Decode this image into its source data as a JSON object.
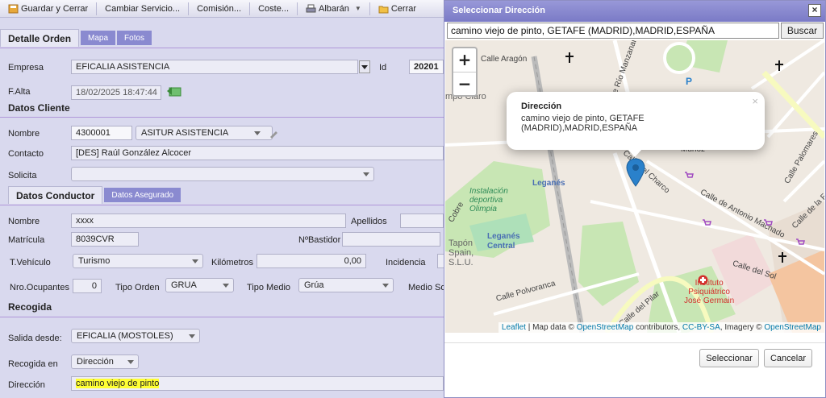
{
  "toolbar": {
    "save_close": "Guardar y Cerrar",
    "change_service": "Cambiar Servicio...",
    "commission": "Comisión...",
    "cost": "Coste...",
    "delivery_note": "Albarán",
    "close": "Cerrar"
  },
  "order": {
    "tab_active": "Detalle Orden",
    "tab_map": "Mapa",
    "tab_photos": "Fotos",
    "company_label": "Empresa",
    "company_value": "EFICALIA ASISTENCIA",
    "id_label": "Id",
    "id_value": "20201",
    "falta_label": "F.Alta",
    "falta_value": "18/02/2025 18:47:44"
  },
  "client": {
    "title": "Datos Cliente",
    "name_label": "Nombre",
    "name_code": "4300001",
    "name_value": "ASITUR ASISTENCIA",
    "contact_label": "Contacto",
    "contact_value": "[DES] Raúl González Alcocer",
    "request_label": "Solicita",
    "request_value": ""
  },
  "driver": {
    "tab_active": "Datos Conductor",
    "tab_insured": "Datos Asegurado",
    "name_label": "Nombre",
    "name_value": "xxxx",
    "surname_label": "Apellidos",
    "plate_label": "Matrícula",
    "plate_value": "8039CVR",
    "frame_label": "NºBastidor",
    "vtype_label": "T.Vehículo",
    "vtype_value": "Turismo",
    "km_label": "Kilómetros",
    "km_value": "0,00",
    "incident_label": "Incidencia",
    "occupants_label": "Nro.Ocupantes",
    "occupants_value": "0",
    "order_type_label": "Tipo Orden",
    "order_type_value": "GRUA",
    "medium_type_label": "Tipo Medio",
    "medium_type_value": "Grúa",
    "medium_label": "Medio So"
  },
  "pickup": {
    "title": "Recogida",
    "exit_label": "Salida desde:",
    "exit_value": "EFICALIA (MOSTOLES)",
    "pickup_in_label": "Recogida en",
    "pickup_in_value": "Dirección",
    "address_label": "Dirección",
    "address_value": "camino viejo de pinto"
  },
  "dialog": {
    "title": "Seleccionar Dirección",
    "search_value": "camino viejo de pinto, GETAFE (MADRID),MADRID,ESPAÑA",
    "search_button": "Buscar",
    "zoom_in": "+",
    "zoom_out": "−",
    "popup_title": "Dirección",
    "popup_body": "camino viejo de pinto, GETAFE (MADRID),MADRID,ESPAÑA",
    "popup_close": "×",
    "select_button": "Seleccionar",
    "cancel_button": "Cancelar",
    "attribution": {
      "leaflet": "Leaflet",
      "sep1": " | Map data © ",
      "osm": "OpenStreetMap",
      "contrib": " contributors, ",
      "license": "CC-BY-SA",
      "imagery": ", Imagery © ",
      "osm2": "OpenStreetMap"
    },
    "map_labels": {
      "calle_aragon": "Calle Aragón",
      "campo_claro": "mpo Claro",
      "leganes": "Leganés",
      "leganes_central": "Leganés\nCentral",
      "instalacion": "Instalación\ndeportiva\nOlimpia",
      "tapon": "Tapón\nSpain,\nS.L.U.",
      "calle_charco": "Calle del Charco",
      "munoz": "Muñoz",
      "antonio_machado": "Calle de Antonio Machado",
      "calle_sol": "Calle del Sol",
      "calle_polvoranca": "Calle Polvoranca",
      "calle_pilar": "Calle del Pilar",
      "instituto": "Instituto\nPsiquiátrico\nJosé Germain",
      "calle_palomares": "Calle Palomares",
      "calle_fuente": "Calle de la Fuente",
      "calle_rio_manzanares": "Calle Río Manzanares",
      "cobre": "Cobre"
    }
  },
  "colors": {
    "accent": "#8a8ad0",
    "dialog_title": "#7a7ac6",
    "highlight": "#ffff33",
    "marker": "#2a81cb"
  }
}
